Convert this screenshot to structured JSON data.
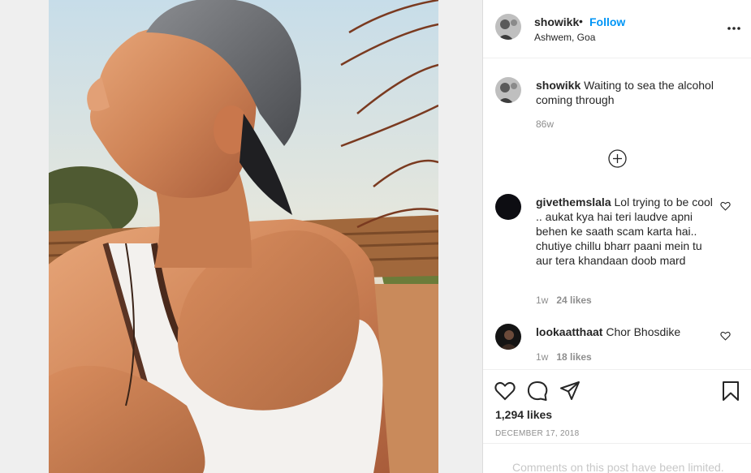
{
  "post": {
    "username": "showikk",
    "separator": "•",
    "follow_label": "Follow",
    "location": "Ashwem, Goa"
  },
  "caption": {
    "username": "showikk",
    "text": "Waiting to sea the alcohol coming through",
    "time": "86w"
  },
  "comments": [
    {
      "username": "givethemslala",
      "text": "Lol trying to be cool .. aukat kya hai teri laudve apni behen ke saath scam karta hai.. chutiye chillu bharr paani mein tu aur tera khandaan doob mard",
      "time": "1w",
      "likes": "24 likes"
    },
    {
      "username": "lookaatthaat",
      "text": "Chor Bhosdike",
      "time": "1w",
      "likes": "18 likes"
    }
  ],
  "engagement": {
    "likes_count": "1,294 likes",
    "date": "DECEMBER 17, 2018",
    "comments_limited": "Comments on this post have been limited."
  },
  "icons": {
    "more": "more-options-icon",
    "load_more": "plus-circle-icon",
    "like": "heart-icon",
    "comment": "comment-bubble-icon",
    "share": "paper-plane-icon",
    "save": "bookmark-icon"
  },
  "colors": {
    "follow_blue": "#0095f6",
    "text": "#262626",
    "muted": "#8e8e8e",
    "border": "#dbdbdb"
  }
}
